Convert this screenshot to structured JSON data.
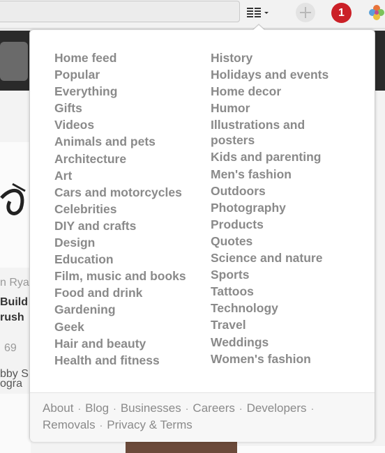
{
  "topbar": {
    "notification_count": "1",
    "colors": {
      "notification_bg": "#cb2027"
    }
  },
  "background": {
    "snippets": [
      "n Ryan",
      "Build",
      "rush",
      "69",
      "bby S",
      "ogra"
    ]
  },
  "dropdown": {
    "left_categories": [
      "Home feed",
      "Popular",
      "Everything",
      "Gifts",
      "Videos",
      "Animals and pets",
      "Architecture",
      "Art",
      "Cars and motorcycles",
      "Celebrities",
      "DIY and crafts",
      "Design",
      "Education",
      "Film, music and books",
      "Food and drink",
      "Gardening",
      "Geek",
      "Hair and beauty",
      "Health and fitness"
    ],
    "right_categories": [
      "History",
      "Holidays and events",
      "Home decor",
      "Humor",
      "Illustrations and posters",
      "Kids and parenting",
      "Men's fashion",
      "Outdoors",
      "Photography",
      "Products",
      "Quotes",
      "Science and nature",
      "Sports",
      "Tattoos",
      "Technology",
      "Travel",
      "Weddings",
      "Women's fashion"
    ],
    "footer_links": [
      "About",
      "Blog",
      "Businesses",
      "Careers",
      "Developers",
      "Removals",
      "Privacy & Terms"
    ]
  }
}
